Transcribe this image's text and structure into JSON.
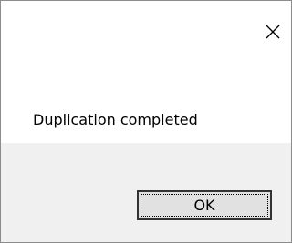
{
  "dialog": {
    "message": "Duplication completed",
    "ok_label": "OK",
    "close_icon": "close-icon"
  },
  "colors": {
    "footer_background": "#f0f0f0",
    "button_background": "#e1e1e1",
    "button_border": "#333333"
  }
}
